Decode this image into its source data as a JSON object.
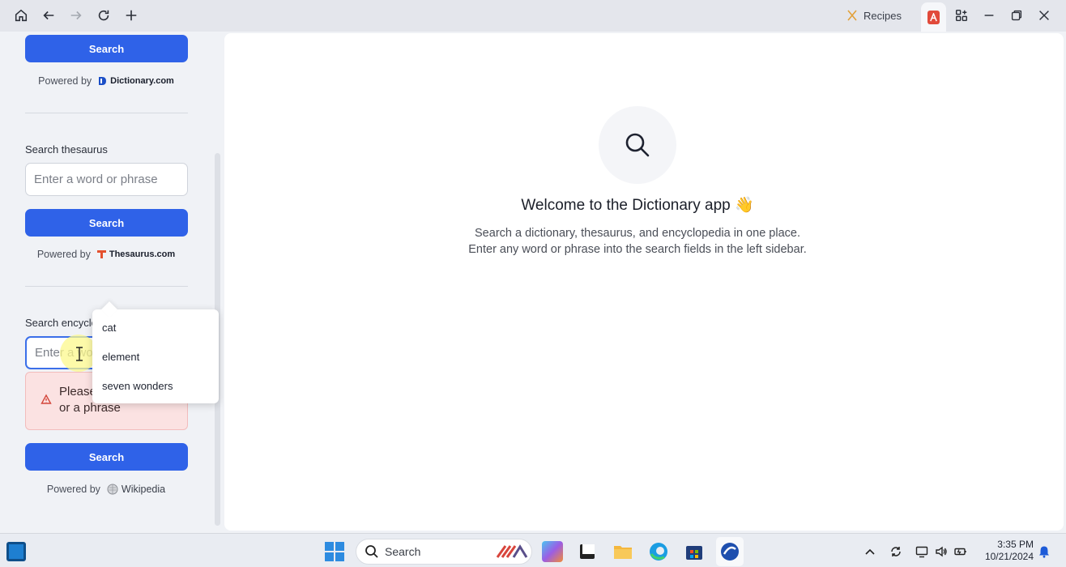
{
  "topbar": {
    "recipes_label": "Recipes",
    "icons": [
      "home-icon",
      "back-icon",
      "forward-icon",
      "refresh-icon",
      "plus-icon",
      "widgets-icon",
      "minimize-icon",
      "restore-icon",
      "close-icon"
    ]
  },
  "sidebar": {
    "dictionary": {
      "search_label": "Search",
      "powered_by": "Powered by",
      "brand": "Dictionary.com"
    },
    "thesaurus": {
      "label": "Search thesaurus",
      "placeholder": "Enter a word or phrase",
      "search_label": "Search",
      "powered_by": "Powered by",
      "brand": "Thesaurus.com"
    },
    "encyclopedia": {
      "label": "Search encyclo",
      "placeholder": "Enter a wor",
      "error": "Please enter a word or a phrase",
      "search_label": "Search",
      "powered_by": "Powered by",
      "brand": "Wikipedia"
    },
    "suggestions": [
      "cat",
      "element",
      "seven wonders"
    ]
  },
  "main": {
    "welcome": "Welcome to the Dictionary app 👋",
    "line1": "Search a dictionary, thesaurus, and encyclopedia in one place.",
    "line2": "Enter any word or phrase into the search fields in the left sidebar."
  },
  "taskbar": {
    "search_label": "Search",
    "time": "3:35 PM",
    "date": "10/21/2024"
  },
  "colors": {
    "accent": "#2f62e8",
    "error_bg": "#fbe2e2",
    "brand_red": "#e14a3b"
  }
}
